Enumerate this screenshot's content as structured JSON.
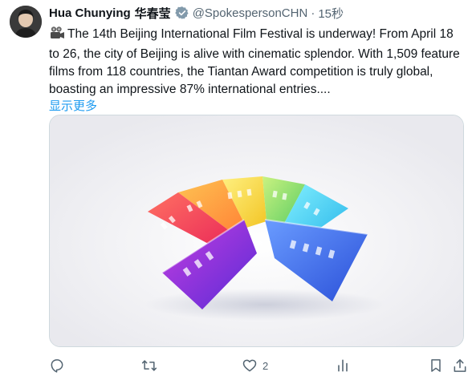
{
  "user": {
    "name": "Hua Chunying",
    "name_cn": "华春莹",
    "handle": "@SpokespersonCHN",
    "time": "15秒"
  },
  "tweet": {
    "text": "The 14th Beijing International Film Festival is underway! From April 18 to 26, the city of Beijing is alive with cinematic splendor. With 1,509 feature films from 118 countries, the Tiantan Award competition is truly global, boasting an impressive 87% international entries....",
    "show_more": "显示更多"
  },
  "actions": {
    "like_count": "2"
  },
  "colors": {
    "accent": "#1d9bf0",
    "secondary_text": "#536471"
  }
}
